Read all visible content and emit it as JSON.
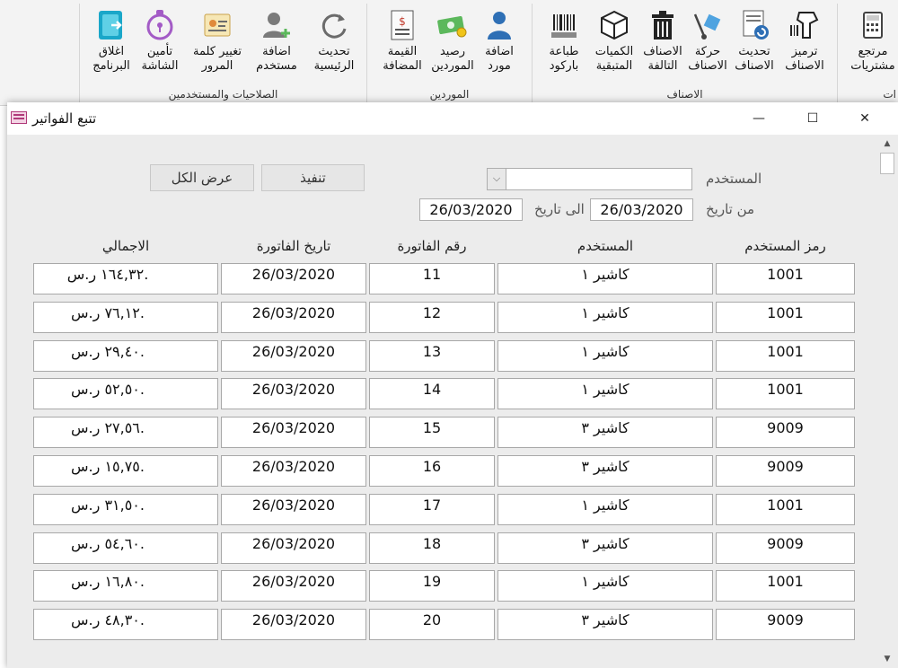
{
  "ribbon": {
    "groups": [
      {
        "label": "الصلاحيات والمستخدمين",
        "buttons": [
          {
            "label": "اغلاق\nالبرنامج",
            "icon": "exit-icon"
          },
          {
            "label": "تأمين\nالشاشة",
            "icon": "lock-icon"
          },
          {
            "label": "تغيير كلمة\nالمرور",
            "icon": "password-card-icon"
          },
          {
            "label": "اضافة\nمستخدم",
            "icon": "add-user-icon"
          },
          {
            "label": "تحديث\nالرئيسية",
            "icon": "refresh-icon"
          }
        ]
      },
      {
        "label": "الموردين",
        "buttons": [
          {
            "label": "القيمة\nالمضافة",
            "icon": "vat-icon"
          },
          {
            "label": "رصيد\nالموردين",
            "icon": "money-icon"
          },
          {
            "label": "اضافة\nمورد",
            "icon": "person-icon"
          }
        ]
      },
      {
        "label": "الاصناف",
        "buttons": [
          {
            "label": "طباعة\nباركود",
            "icon": "barcode-print-icon"
          },
          {
            "label": "الكميات\nالمتبقية",
            "icon": "box-icon"
          },
          {
            "label": "الاصناف\nالتالفة",
            "icon": "trash-icon"
          },
          {
            "label": "حركة\nالاصناف",
            "icon": "hand-truck-icon"
          },
          {
            "label": "تحديث\nالاصناف",
            "icon": "refresh-doc-icon"
          },
          {
            "label": "ترميز\nالاصناف",
            "icon": "barcode-scanner-icon"
          }
        ]
      },
      {
        "label": "ات",
        "buttons": [
          {
            "label": "مرتجع\nمشتريات",
            "icon": "calculator-icon"
          }
        ]
      }
    ]
  },
  "window": {
    "title": "تتبع الفواتير",
    "minimize": "—",
    "maximize": "☐",
    "close": "✕"
  },
  "filters": {
    "user_label": "المستخدم",
    "user_value": "",
    "from_label": "من تاريخ",
    "from_value": "26/03/2020",
    "to_label": "الى تاريخ",
    "to_value": "26/03/2020",
    "execute_label": "تنفيذ",
    "show_all_label": "عرض الكل"
  },
  "table": {
    "headers": {
      "user_code": "رمز المستخدم",
      "user": "المستخدم",
      "invoice_no": "رقم الفاتورة",
      "invoice_date": "تاريخ الفاتورة",
      "total": "الاجمالي"
    },
    "rows": [
      {
        "user_code": "1001",
        "user": "كاشير ١",
        "invoice_no": "11",
        "invoice_date": "26/03/2020",
        "total": "١٦٤,٣٢ ر.س."
      },
      {
        "user_code": "1001",
        "user": "كاشير ١",
        "invoice_no": "12",
        "invoice_date": "26/03/2020",
        "total": "٧٦,١٢ ر.س."
      },
      {
        "user_code": "1001",
        "user": "كاشير ١",
        "invoice_no": "13",
        "invoice_date": "26/03/2020",
        "total": "٢٩,٤٠ ر.س."
      },
      {
        "user_code": "1001",
        "user": "كاشير ١",
        "invoice_no": "14",
        "invoice_date": "26/03/2020",
        "total": "٥٢,٥٠ ر.س."
      },
      {
        "user_code": "9009",
        "user": "كاشير ٣",
        "invoice_no": "15",
        "invoice_date": "26/03/2020",
        "total": "٢٧,٥٦ ر.س."
      },
      {
        "user_code": "9009",
        "user": "كاشير ٣",
        "invoice_no": "16",
        "invoice_date": "26/03/2020",
        "total": "١٥,٧٥ ر.س."
      },
      {
        "user_code": "1001",
        "user": "كاشير ١",
        "invoice_no": "17",
        "invoice_date": "26/03/2020",
        "total": "٣١,٥٠ ر.س."
      },
      {
        "user_code": "9009",
        "user": "كاشير ٣",
        "invoice_no": "18",
        "invoice_date": "26/03/2020",
        "total": "٥٤,٦٠ ر.س."
      },
      {
        "user_code": "1001",
        "user": "كاشير ١",
        "invoice_no": "19",
        "invoice_date": "26/03/2020",
        "total": "١٦,٨٠ ر.س."
      },
      {
        "user_code": "9009",
        "user": "كاشير ٣",
        "invoice_no": "20",
        "invoice_date": "26/03/2020",
        "total": "٤٨,٣٠ ر.س."
      }
    ]
  }
}
